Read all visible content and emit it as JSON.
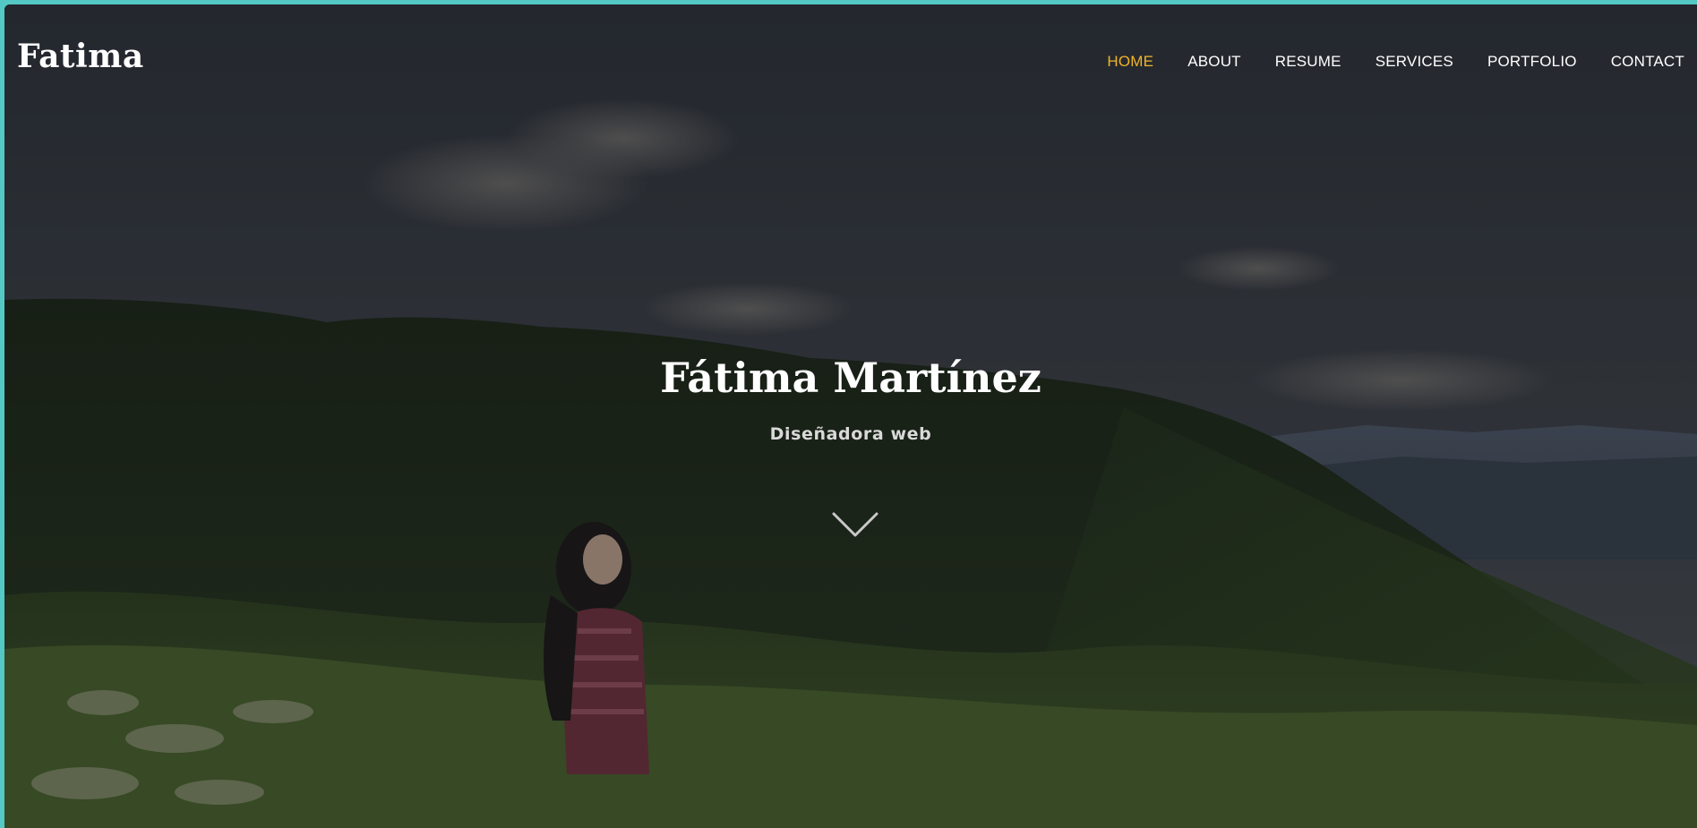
{
  "brand": {
    "name": "Fatima"
  },
  "nav": {
    "items": [
      {
        "label": "HOME",
        "active": true
      },
      {
        "label": "ABOUT",
        "active": false
      },
      {
        "label": "RESUME",
        "active": false
      },
      {
        "label": "SERVICES",
        "active": false
      },
      {
        "label": "PORTFOLIO",
        "active": false
      },
      {
        "label": "CONTACT",
        "active": false
      }
    ]
  },
  "hero": {
    "title": "Fátima Martínez",
    "subtitle": "Diseñadora web",
    "scroll_icon": "chevron-down-icon",
    "background": "mountain-landscape-photo"
  },
  "colors": {
    "accent": "#f0b429",
    "frame": "#54c8c4",
    "text": "#ffffff"
  }
}
